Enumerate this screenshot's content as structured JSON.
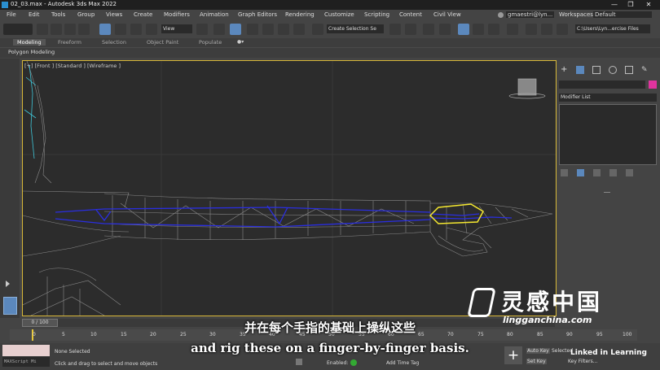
{
  "window": {
    "title": "02_03.max - Autodesk 3ds Max 2022"
  },
  "menu": {
    "items": [
      "File",
      "Edit",
      "Tools",
      "Group",
      "Views",
      "Create",
      "Modifiers",
      "Animation",
      "Graph Editors",
      "Rendering",
      "Customize",
      "Scripting",
      "Content",
      "Civil View"
    ],
    "user": "gmaestri@lyn...",
    "workspaces_label": "Workspaces:",
    "workspace_value": "Default"
  },
  "toolbar": {
    "view_dropdown": "View",
    "selection_set": "Create Selection Se",
    "project_path": "C:\\Users\\Lyn...ercise Files"
  },
  "ribbon": {
    "tabs": [
      "Modeling",
      "Freeform",
      "Selection",
      "Object Paint",
      "Populate"
    ],
    "active_tab": "Modeling",
    "sub_label": "Polygon Modeling"
  },
  "viewport": {
    "label": "[+] [Front ] [Standard ] [Wireframe ]"
  },
  "command_panel": {
    "modifier_list": "Modifier List"
  },
  "timeline": {
    "frame_display": "0 / 100",
    "ticks": [
      "0",
      "5",
      "10",
      "15",
      "20",
      "25",
      "30",
      "35",
      "40",
      "45",
      "50",
      "55",
      "60",
      "65",
      "70",
      "75",
      "80",
      "85",
      "90",
      "95",
      "100"
    ]
  },
  "status": {
    "maxscript": "MAXScript Mi",
    "selection": "None Selected",
    "hint": "Click and drag to select and move objects",
    "enabled": "Enabled:",
    "add_time_tag": "Add Time Tag",
    "auto_key": "Auto Key",
    "set_key": "Set Key",
    "selected": "Selected",
    "key_filters": "Key Filters..."
  },
  "subtitles": {
    "chinese": "并在每个手指的基础上操纵这些",
    "english": "and rig these on a finger-by-finger basis."
  },
  "watermarks": {
    "linkedin": "Linked in Learning",
    "cn_brand": "灵感中国",
    "cn_url": "lingganchina.com"
  },
  "colors": {
    "viewport_border": "#d8b838",
    "bone": "#2a2ee0",
    "selection_outline": "#f5e830",
    "accent_blue": "#5b88bd"
  }
}
